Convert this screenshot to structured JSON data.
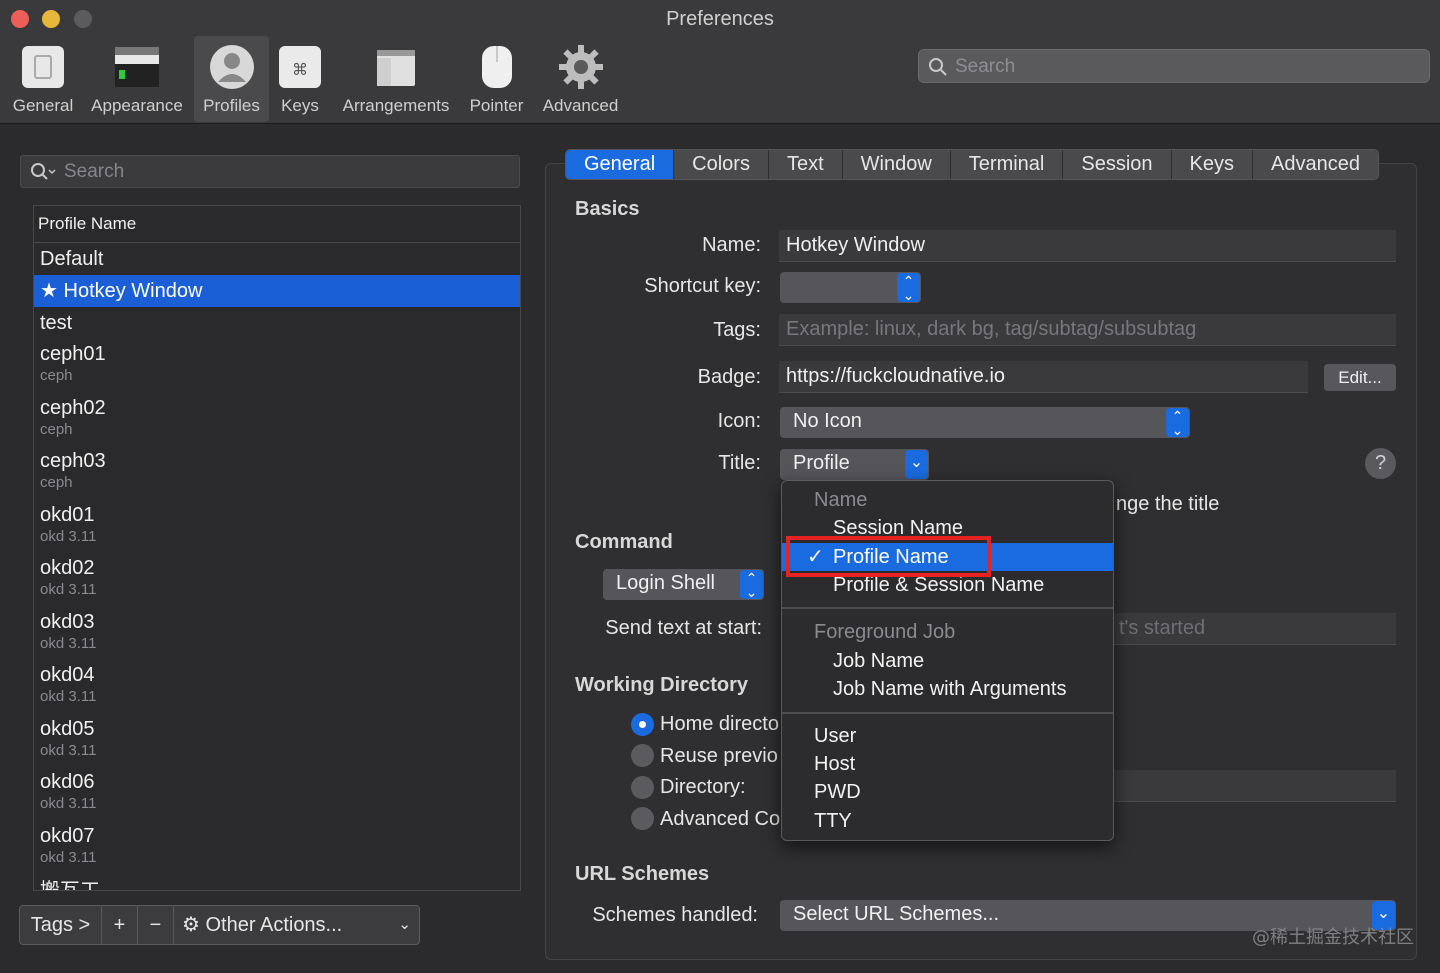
{
  "window": {
    "title": "Preferences"
  },
  "toolbar": {
    "items": [
      {
        "label": "General",
        "icon": "general-switch-icon"
      },
      {
        "label": "Appearance",
        "icon": "appearance-window-icon"
      },
      {
        "label": "Profiles",
        "icon": "profiles-person-icon",
        "active": true
      },
      {
        "label": "Keys",
        "icon": "keys-command-icon"
      },
      {
        "label": "Arrangements",
        "icon": "arrangements-windows-icon"
      },
      {
        "label": "Pointer",
        "icon": "pointer-mouse-icon"
      },
      {
        "label": "Advanced",
        "icon": "advanced-gear-icon"
      }
    ],
    "search_placeholder": "Search"
  },
  "left": {
    "search_placeholder": "Search",
    "header": "Profile Name",
    "profiles": [
      {
        "name": "Default",
        "tag": ""
      },
      {
        "name": "Hotkey Window",
        "tag": "",
        "selected": true,
        "starred": true
      },
      {
        "name": "test",
        "tag": ""
      },
      {
        "name": "ceph01",
        "tag": "ceph"
      },
      {
        "name": "ceph02",
        "tag": "ceph"
      },
      {
        "name": "ceph03",
        "tag": "ceph"
      },
      {
        "name": "okd01",
        "tag": "okd 3.11"
      },
      {
        "name": "okd02",
        "tag": "okd 3.11"
      },
      {
        "name": "okd03",
        "tag": "okd 3.11"
      },
      {
        "name": "okd04",
        "tag": "okd 3.11"
      },
      {
        "name": "okd05",
        "tag": "okd 3.11"
      },
      {
        "name": "okd06",
        "tag": "okd 3.11"
      },
      {
        "name": "okd07",
        "tag": "okd 3.11"
      },
      {
        "name": "搬瓦工",
        "tag": ""
      }
    ],
    "bottom": {
      "tags": "Tags >",
      "add": "+",
      "remove": "−",
      "other_actions": "Other Actions..."
    }
  },
  "tabs": [
    "General",
    "Colors",
    "Text",
    "Window",
    "Terminal",
    "Session",
    "Keys",
    "Advanced"
  ],
  "active_tab": "General",
  "basics": {
    "section": "Basics",
    "name_label": "Name:",
    "name_value": "Hotkey Window",
    "shortcut_label": "Shortcut key:",
    "tags_label": "Tags:",
    "tags_placeholder": "Example: linux, dark bg, tag/subtag/subsubtag",
    "badge_label": "Badge:",
    "badge_value": "https://fuckcloudnative.io",
    "edit_button": "Edit...",
    "icon_label": "Icon:",
    "icon_value": "No Icon",
    "title_label": "Title:",
    "title_value": "Profile",
    "title_hint_fragment": "nge the title"
  },
  "command": {
    "section": "Command",
    "shell_value": "Login Shell",
    "send_text_label": "Send text at start:",
    "send_text_fragment": "t's started"
  },
  "working_dir": {
    "section": "Working Directory",
    "options": [
      "Home directo",
      "Reuse previo",
      "Directory:",
      "Advanced Co"
    ]
  },
  "url": {
    "section": "URL Schemes",
    "label": "Schemes handled:",
    "value": "Select URL Schemes..."
  },
  "menu": {
    "name_header": "Name",
    "name_items": [
      "Session Name",
      "Profile Name",
      "Profile & Session Name"
    ],
    "selected": "Profile Name",
    "job_header": "Foreground Job",
    "job_items": [
      "Job Name",
      "Job Name with Arguments"
    ],
    "other_items": [
      "User",
      "Host",
      "PWD",
      "TTY"
    ]
  },
  "watermark": "@稀土掘金技术社区",
  "colors": {
    "accent": "#1a6be0",
    "highlight_box": "#e62222",
    "selection": "#1a5fd6"
  }
}
